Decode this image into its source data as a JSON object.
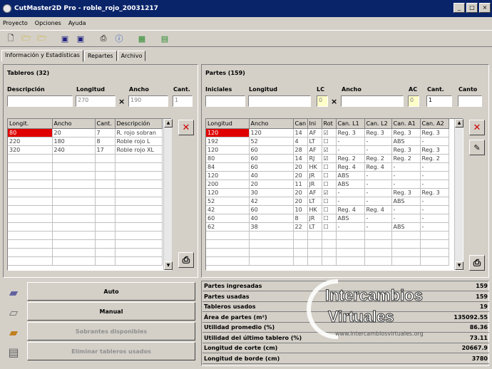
{
  "window": {
    "title": "CutMaster2D Pro - roble_rojo_20031217",
    "min": "_",
    "max": "□",
    "close": "×"
  },
  "menu": [
    "Proyecto",
    "Opciones",
    "Ayuda"
  ],
  "toolbar": {
    "icons": [
      "new-file-icon",
      "open-folder-icon",
      "open-folder2-icon",
      "save-icon",
      "save-as-icon",
      "print-icon",
      "info-icon",
      "palette-icon",
      "calculator-icon"
    ]
  },
  "tabs": [
    "Información y Estadísticas",
    "Repartes",
    "Archivo"
  ],
  "tableros": {
    "title": "Tableros (32)",
    "labels": {
      "descripcion": "Descripción",
      "longitud": "Longitud",
      "ancho": "Ancho",
      "cant": "Cant."
    },
    "inputs": {
      "descripcion": "",
      "longitud": "270",
      "ancho": "190",
      "cant": "1"
    },
    "times": "×",
    "columns": [
      "Longit.",
      "Ancho",
      "Cant.",
      "Descripción"
    ],
    "rows": [
      [
        "80",
        "20",
        "7",
        "R. rojo sobran"
      ],
      [
        "220",
        "180",
        "8",
        "Roble rojo L"
      ],
      [
        "320",
        "240",
        "17",
        "Roble rojo XL"
      ]
    ]
  },
  "partes": {
    "title": "Partes (159)",
    "labels": {
      "iniciales": "Iniciales",
      "longitud": "Longitud",
      "lc": "LC",
      "ancho": "Ancho",
      "ac": "AC",
      "cant": "Cant.",
      "canto": "Canto"
    },
    "inputs": {
      "iniciales": "",
      "longitud": "",
      "lc": "0",
      "ancho": "",
      "ac": "0",
      "cant": "1",
      "canto": ""
    },
    "times": "×",
    "columns": [
      "Longitud",
      "Ancho",
      "Can",
      "Ini",
      "Rot",
      "Can. L1",
      "Can. L2",
      "Can. A1",
      "Can. A2"
    ],
    "rows": [
      [
        "120",
        "120",
        "14",
        "AF",
        "☑",
        "Reg. 3",
        "Reg. 3",
        "Reg. 3",
        "Reg. 3"
      ],
      [
        "192",
        "52",
        "4",
        "LT",
        "☐",
        "-",
        "-",
        "ABS",
        "-"
      ],
      [
        "120",
        "60",
        "28",
        "AF",
        "☑",
        "-",
        "-",
        "Reg. 3",
        "Reg. 3"
      ],
      [
        "80",
        "60",
        "14",
        "RJ",
        "☑",
        "Reg. 2",
        "Reg. 2",
        "Reg. 2",
        "Reg. 2"
      ],
      [
        "84",
        "60",
        "20",
        "HK",
        "☐",
        "Reg. 4",
        "Reg. 4",
        "-",
        "-"
      ],
      [
        "120",
        "40",
        "20",
        "JR",
        "☐",
        "ABS",
        "-",
        "-",
        "-"
      ],
      [
        "200",
        "20",
        "11",
        "JR",
        "☐",
        "ABS",
        "-",
        "-",
        "-"
      ],
      [
        "120",
        "30",
        "20",
        "AF",
        "☑",
        "-",
        "-",
        "Reg. 3",
        "Reg. 3"
      ],
      [
        "52",
        "42",
        "20",
        "LT",
        "☐",
        "-",
        "-",
        "ABS",
        "-"
      ],
      [
        "42",
        "60",
        "10",
        "HK",
        "☐",
        "Reg. 4",
        "Reg. 4",
        "-",
        "-"
      ],
      [
        "60",
        "40",
        "8",
        "JR",
        "☐",
        "ABS",
        "-",
        "-",
        "-"
      ],
      [
        "62",
        "38",
        "22",
        "LT",
        "☐",
        "-",
        "-",
        "ABS",
        "-"
      ]
    ]
  },
  "actions": {
    "auto": "Auto",
    "manual": "Manual",
    "sobrantes": "Sobrantes disponibles",
    "eliminar": "Eliminar tableros usados"
  },
  "stats": [
    {
      "k": "Partes ingresadas",
      "v": "159"
    },
    {
      "k": "Partes usadas",
      "v": "159"
    },
    {
      "k": "Tableros usados",
      "v": "19"
    },
    {
      "k": "Área de partes (m²)",
      "v": "135092.55"
    },
    {
      "k": "Utilidad promedio (%)",
      "v": "86.36"
    },
    {
      "k": "Utilidad del último tablero (%)",
      "v": "73.11"
    },
    {
      "k": "Longitud de corte (cm)",
      "v": "20667.9"
    },
    {
      "k": "Longitud de borde (cm)",
      "v": "3780"
    }
  ],
  "watermark": {
    "line1": "Intercambios",
    "line2": "Virtuales",
    "url": "www.intercambiosvirtuales.org"
  },
  "colors": {
    "titlebar": "#0a246a",
    "selection": "#e00000",
    "face": "#d4d0c8"
  }
}
